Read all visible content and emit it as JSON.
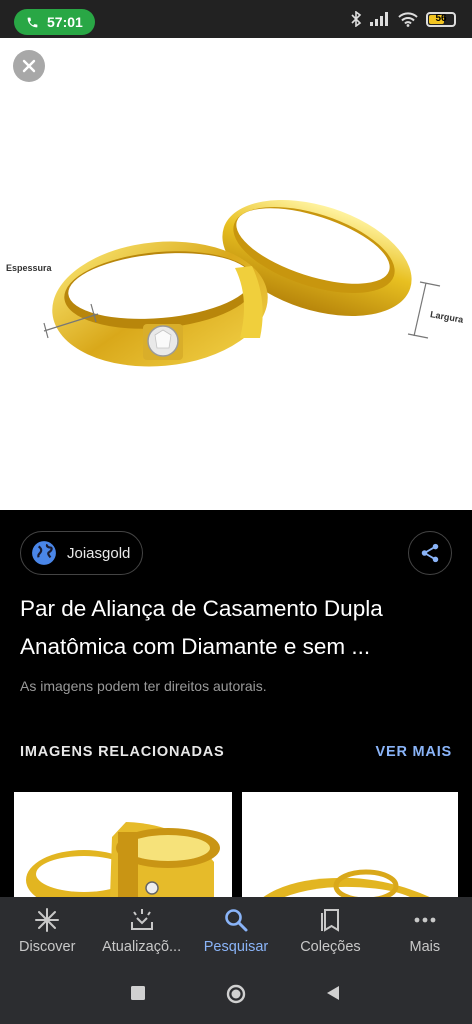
{
  "status_bar": {
    "call_time": "57:01",
    "battery_level": "56"
  },
  "image_viewer": {
    "label_thickness": "Espessura",
    "label_width": "Largura"
  },
  "source": {
    "name": "Joiasgold"
  },
  "result": {
    "title_line1": "Par de Aliança de Casamento Dupla",
    "title_line2": "Anatômica com Diamante e sem ...",
    "copyright_notice": "As imagens podem ter direitos autorais."
  },
  "related": {
    "heading": "IMAGENS RELACIONADAS",
    "see_more": "VER MAIS"
  },
  "bottom_nav": {
    "items": [
      {
        "label": "Discover",
        "icon": "asterisk-icon"
      },
      {
        "label": "Atualizaçõ...",
        "icon": "updates-icon"
      },
      {
        "label": "Pesquisar",
        "icon": "search-icon",
        "active": true
      },
      {
        "label": "Coleções",
        "icon": "collections-icon"
      },
      {
        "label": "Mais",
        "icon": "more-icon"
      }
    ]
  },
  "colors": {
    "accent": "#8ab4f8",
    "call_green": "#29a745",
    "nav_bg": "#2c2d30",
    "gold": "#e8c021"
  }
}
